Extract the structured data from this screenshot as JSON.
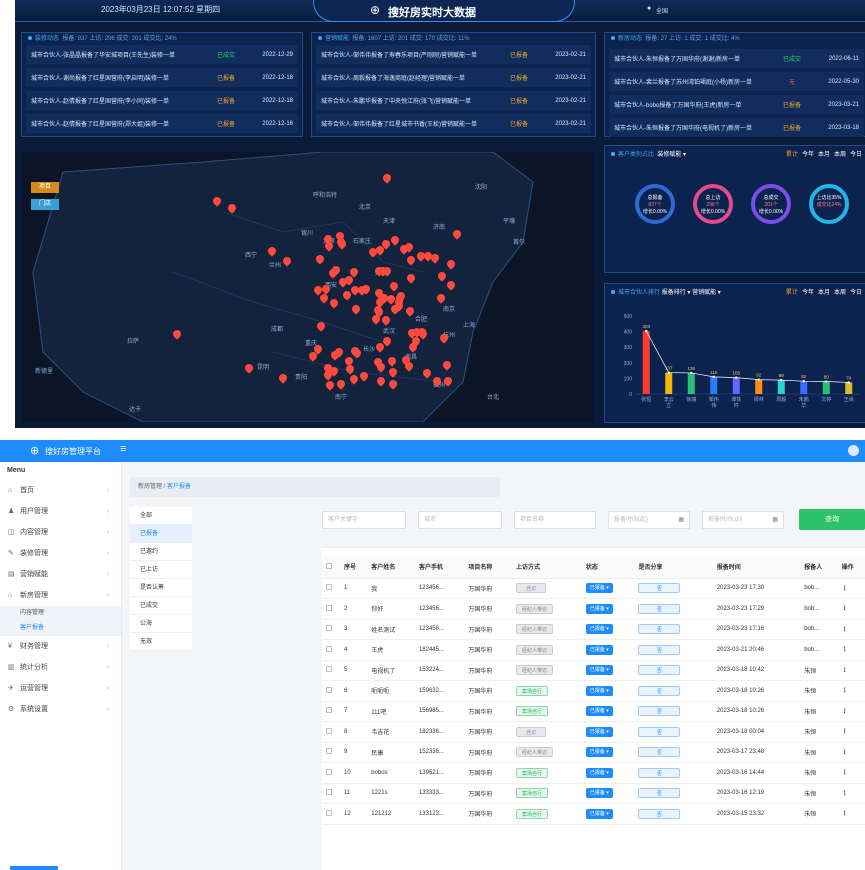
{
  "dashboard": {
    "datetime": "2023年03月23日 12:07:52 星期四",
    "title": "搜好房实时大数据",
    "region": "全国",
    "feeds": [
      {
        "title": "装修动态",
        "stats": "报备: 837 上访: 296 成交: 201 成交比: 24%",
        "items": [
          {
            "text": "城市合伙人-张晶晶报备了华安城项目(王先生)装修一单",
            "status": "已成交",
            "date": "2022-12-29"
          },
          {
            "text": "城市合伙人-谢尚报备了红星国营府(李启明)装修一单",
            "status": "已报备",
            "date": "2022-12-18"
          },
          {
            "text": "城市合伙人-赵倩报备了红星国营府(李小同)装修一单",
            "status": "已报备",
            "date": "2022-12-18"
          },
          {
            "text": "城市合伙人-赵倩报备了红星国营府(郑大姐)装修一单",
            "status": "已报备",
            "date": "2022-12-16"
          }
        ]
      },
      {
        "title": "营销赋能",
        "stats": "报备: 1607 上访: 201 成交: 170 成交比: 11%",
        "items": [
          {
            "text": "城市合伙人-邹伟伟报备了寿春乐项目(严刚刚)营销赋能一单",
            "status": "已报备",
            "date": "2023-02-21"
          },
          {
            "text": "城市合伙人-周毅报备了海逸商庭(赵经理)营销赋能一单",
            "status": "已报备",
            "date": "2023-02-21"
          },
          {
            "text": "城市合伙人-朱鹏华报备了中央悦江府(张飞)营销赋能一单",
            "status": "已报备",
            "date": "2023-02-21"
          },
          {
            "text": "城市合伙人-邹伟伟报备了红星城市书香(王松)营销赋能一单",
            "status": "已报备",
            "date": "2023-02-21"
          }
        ]
      },
      {
        "title": "新房动态",
        "stats": "报备: 27 上访: 1 成交: 1 成交比: 4%",
        "items": [
          {
            "text": "城市合伙人-朱恒报备了万国华府(谢谢)新房一单",
            "status": "已成交",
            "date": "2022-06-11"
          },
          {
            "text": "城市合伙人-裴兰报备了苏州湾铂珺庭(小杨)新房一单",
            "status": "无",
            "date": "2022-05-30"
          },
          {
            "text": "城市合伙人-bobo报备了万国华府(王虎)新房一单",
            "status": "已报备",
            "date": "2023-03-21"
          },
          {
            "text": "城市合伙人-朱恒报备了万国华府(电视机了)新房一单",
            "status": "已报备",
            "date": "2023-03-18"
          }
        ]
      }
    ],
    "map": {
      "btn_project": "项目",
      "btn_store": "门店",
      "cities": [
        "呼和浩特",
        "沈阳",
        "北京",
        "天津",
        "银川",
        "太原",
        "石家庄",
        "济南",
        "平壤",
        "首尔",
        "西宁",
        "兰州",
        "郑州",
        "西安",
        "合肥",
        "南京",
        "上海",
        "拉萨",
        "成都",
        "重庆",
        "武汉",
        "杭州",
        "长沙",
        "南昌",
        "贵阳",
        "福州",
        "台北",
        "昆明",
        "南宁",
        "新德里",
        "达卡"
      ]
    },
    "customer": {
      "title": "客户类别占比",
      "select": "装修赋能",
      "tabs": [
        "累计",
        "今年",
        "本月",
        "本周",
        "今日"
      ],
      "circles": [
        {
          "label": "总报备",
          "value": "837个",
          "growth": "增长0.00%"
        },
        {
          "label": "总上访",
          "value": "296个",
          "growth": "增长0.00%"
        },
        {
          "label": "总成交",
          "value": "201个",
          "growth": "增长0.00%"
        },
        {
          "label": "上访比35%",
          "value": "成交比24%",
          "growth": ""
        }
      ]
    },
    "ranking": {
      "title": "城市合伙人排行",
      "select1": "报备排行",
      "select2": "营销赋能",
      "tabs": [
        "累计",
        "今年",
        "本月",
        "本周",
        "今日"
      ]
    },
    "chart_data": {
      "type": "bar",
      "categories": [
        "张恒",
        "李云立",
        "徐瑞",
        "邹伟伟",
        "谭铁杵",
        "周林",
        "周毅",
        "朱鹏华",
        "文婷",
        "王尚"
      ],
      "values": [
        403,
        137,
        135,
        110,
        105,
        92,
        89,
        82,
        80,
        74
      ],
      "ylim": [
        0,
        500
      ],
      "yticks": [
        0,
        100,
        200,
        300,
        400,
        500
      ],
      "colors": [
        "#ff3b2f",
        "#f5b800",
        "#2bbf7a",
        "#2b7bff",
        "#6b64ff",
        "#ff8c1a",
        "#2ad3d3",
        "#3d6bff",
        "#24c270",
        "#d9c02a"
      ],
      "line": true
    }
  },
  "admin": {
    "app_name": "搜好房管理平台",
    "menu_title": "Menu",
    "menu": [
      {
        "icon": "⌂",
        "label": "首页"
      },
      {
        "icon": "♟",
        "label": "用户管理"
      },
      {
        "icon": "◫",
        "label": "内容管理"
      },
      {
        "icon": "✎",
        "label": "装修管理"
      },
      {
        "icon": "▤",
        "label": "营销赋能"
      },
      {
        "icon": "⌂",
        "label": "新房管理"
      }
    ],
    "submenu": [
      "内容管理",
      "客户报备"
    ],
    "menu2": [
      {
        "icon": "¥",
        "label": "财务管理"
      },
      {
        "icon": "▥",
        "label": "统计分析"
      },
      {
        "icon": "✈",
        "label": "运营管理"
      },
      {
        "icon": "⚙",
        "label": "系统设置"
      }
    ],
    "breadcrumb_root": "新房管理",
    "breadcrumb_current": "客户报备",
    "filters": [
      "全部",
      "已报备",
      "已邀约",
      "已上访",
      "是否认筹",
      "已成交",
      "公海",
      "无效"
    ],
    "inputs": {
      "keyword": "客户关键字",
      "city": "城市",
      "project": "项目名称",
      "start": "报备时间(起)",
      "end": "报备时间(止)"
    },
    "search_btn": "查询",
    "columns": [
      "序号",
      "客户姓名",
      "客户手机",
      "项目名称",
      "上访方式",
      "状态",
      "是否分享",
      "报备时间",
      "报备人",
      "操作"
    ],
    "rows": [
      {
        "no": "1",
        "name": "我",
        "phone": "123456...",
        "project": "万国华府",
        "visit": "自访",
        "status": "已报备",
        "share": "否",
        "time": "2023-03-23 17:30",
        "reporter": "bob..."
      },
      {
        "no": "2",
        "name": "你好",
        "phone": "123456...",
        "project": "万国华府",
        "visit": "经纪人带访",
        "status": "已报备",
        "share": "否",
        "time": "2023-03-23 17:29",
        "reporter": "bob..."
      },
      {
        "no": "3",
        "name": "姓名测试",
        "phone": "123456...",
        "project": "万国华府",
        "visit": "经纪人带访",
        "status": "已报备",
        "share": "否",
        "time": "2023-03-23 17:16",
        "reporter": "bob..."
      },
      {
        "no": "4",
        "name": "王虎",
        "phone": "182445...",
        "project": "万国华府",
        "visit": "经纪人带访",
        "status": "已报备",
        "share": "否",
        "time": "2023-03-21 20:46",
        "reporter": "bob..."
      },
      {
        "no": "5",
        "name": "电视机了",
        "phone": "153224...",
        "project": "万国华府",
        "visit": "经纪人带访",
        "status": "已报备",
        "share": "否",
        "time": "2023-03-18 10:42",
        "reporter": "朱恒"
      },
      {
        "no": "6",
        "name": "呃呃呃",
        "phone": "159632...",
        "project": "万国华府",
        "visit": "案场自行",
        "status": "已报备",
        "share": "否",
        "time": "2023-03-18 10:26",
        "reporter": "朱恒"
      },
      {
        "no": "7",
        "name": "111吧",
        "phone": "156985...",
        "project": "万国华府",
        "visit": "案场自行",
        "status": "已报备",
        "share": "否",
        "time": "2023-03-18 10:26",
        "reporter": "朱恒"
      },
      {
        "no": "8",
        "name": "韦吉花",
        "phone": "182336...",
        "project": "万国华府",
        "visit": "自访",
        "status": "已报备",
        "share": "否",
        "time": "2023-03-18 00:04",
        "reporter": "朱恒"
      },
      {
        "no": "9",
        "name": "民康",
        "phone": "152336...",
        "project": "万国华府",
        "visit": "经纪人带访",
        "status": "已报备",
        "share": "否",
        "time": "2023-03-17 23:48",
        "reporter": "朱恒"
      },
      {
        "no": "10",
        "name": "bobos",
        "phone": "139521...",
        "project": "万国华府",
        "visit": "案场自行",
        "status": "已报备",
        "share": "否",
        "time": "2023-03-16 14:44",
        "reporter": "朱恒"
      },
      {
        "no": "11",
        "name": "1221s",
        "phone": "133333...",
        "project": "万国华府",
        "visit": "案场自行",
        "status": "已报备",
        "share": "否",
        "time": "2023-03-16 12:19",
        "reporter": "朱恒"
      },
      {
        "no": "12",
        "name": "121212",
        "phone": "133123...",
        "project": "万国华府",
        "visit": "案场自行",
        "status": "已报备",
        "share": "否",
        "time": "2023-03-15 23:32",
        "reporter": "朱恒"
      }
    ]
  }
}
